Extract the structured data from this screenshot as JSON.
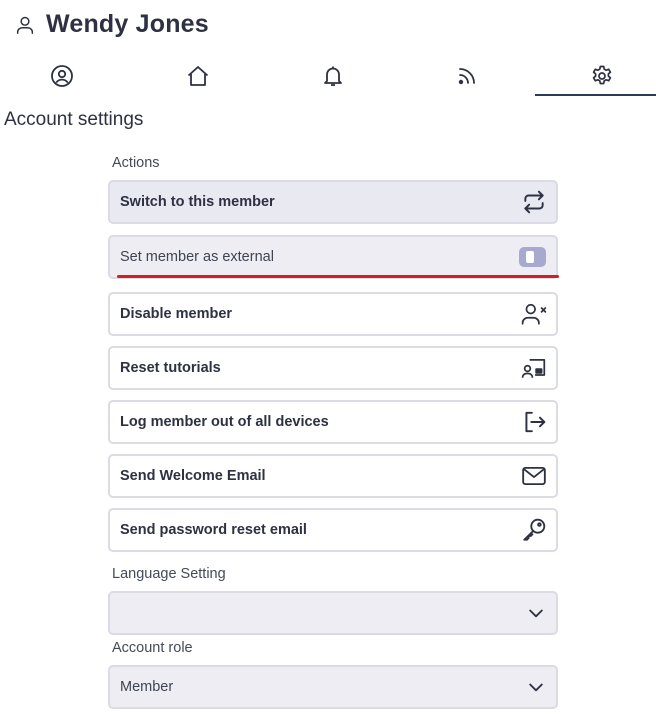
{
  "user": {
    "name": "Wendy Jones",
    "icon": "user-icon"
  },
  "tabs": [
    {
      "name": "profile",
      "icon": "user-circle-icon"
    },
    {
      "name": "home",
      "icon": "home-icon"
    },
    {
      "name": "notifications",
      "icon": "bell-icon"
    },
    {
      "name": "feed",
      "icon": "rss-icon"
    },
    {
      "name": "settings",
      "icon": "gear-icon",
      "active": true
    }
  ],
  "section_title": "Account settings",
  "actions_label": "Actions",
  "actions": [
    {
      "label": "Switch to this member",
      "icon": "switch-arrows-icon"
    },
    {
      "label": "Disable member",
      "icon": "user-remove-icon"
    },
    {
      "label": "Reset tutorials",
      "icon": "screen-share-icon"
    },
    {
      "label": "Log member out of all devices",
      "icon": "logout-icon"
    },
    {
      "label": "Send Welcome Email",
      "icon": "mail-icon"
    },
    {
      "label": "Send password reset email",
      "icon": "key-icon"
    }
  ],
  "external_toggle": {
    "label": "Set member as external",
    "checked": false
  },
  "language": {
    "label": "Language Setting",
    "value": ""
  },
  "role": {
    "label": "Account role",
    "value": "Member"
  },
  "colors": {
    "text": "#2d3142",
    "border": "#dadbe3",
    "toggle": "#a8a9cf",
    "highlight_underline": "#d02020",
    "active_tab": "#2d3a5c"
  }
}
